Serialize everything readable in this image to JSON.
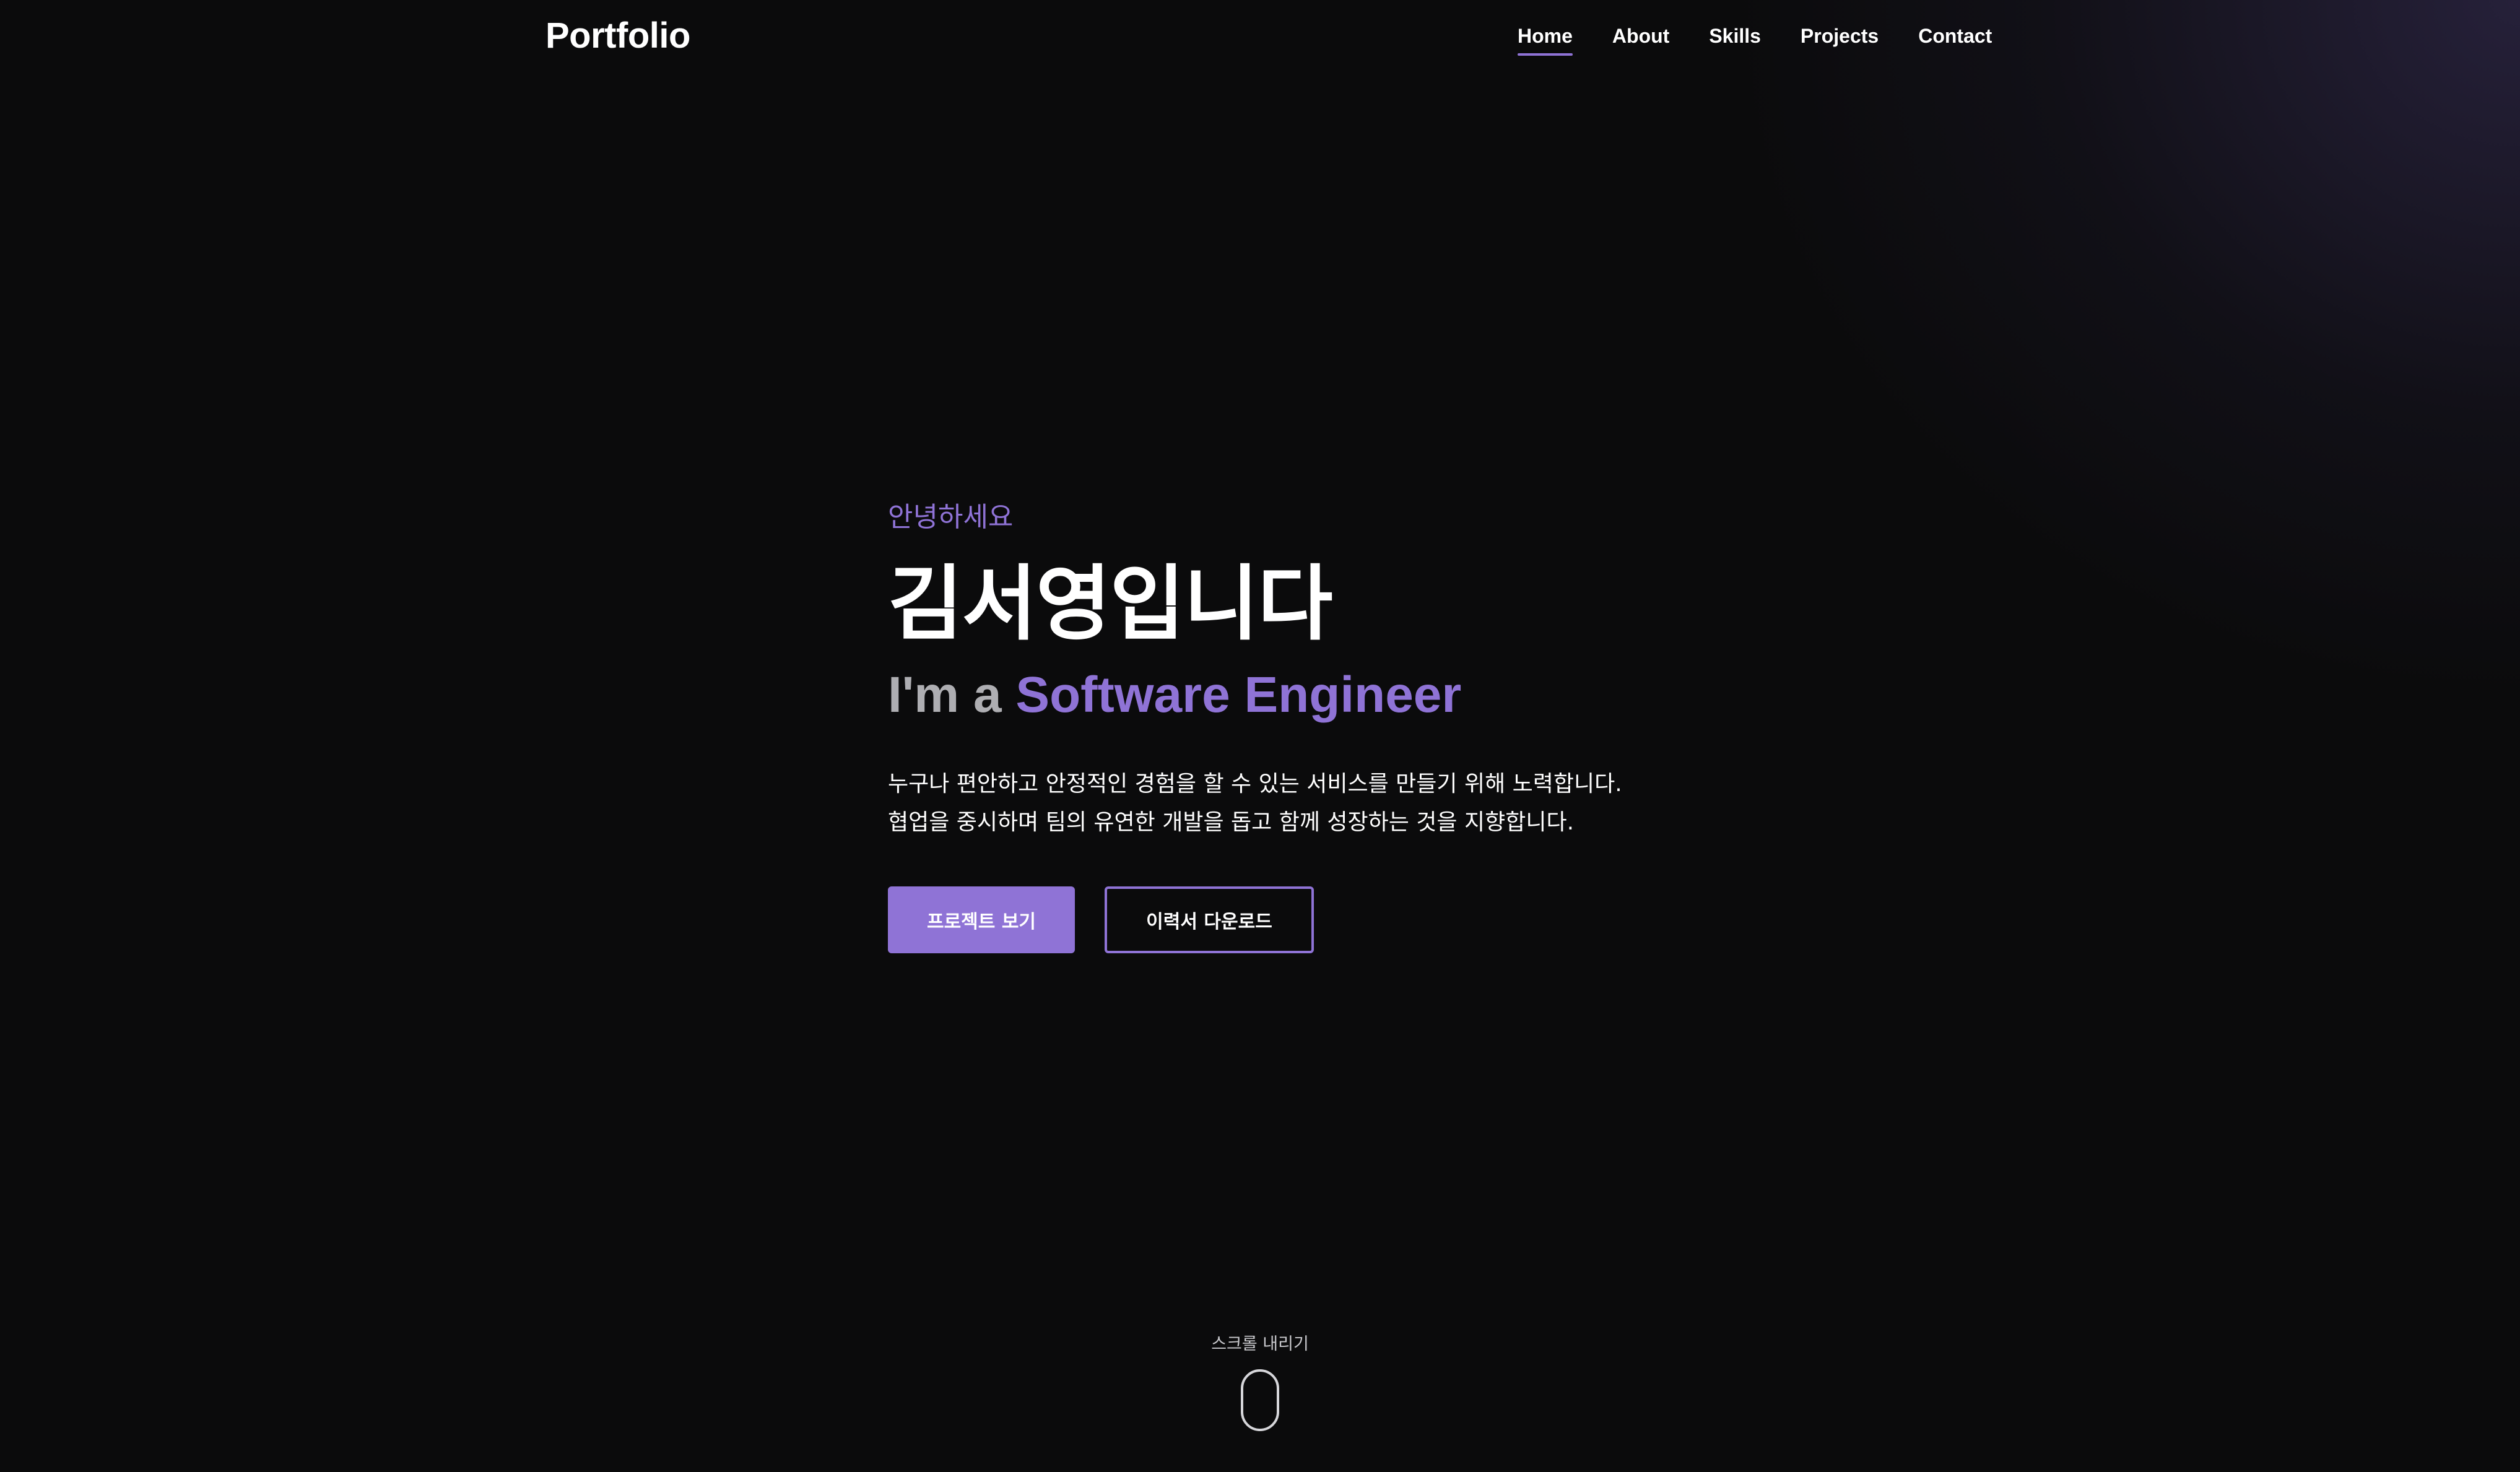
{
  "header": {
    "logo": "Portfolio",
    "nav": [
      {
        "label": "Home",
        "active": true
      },
      {
        "label": "About",
        "active": false
      },
      {
        "label": "Skills",
        "active": false
      },
      {
        "label": "Projects",
        "active": false
      },
      {
        "label": "Contact",
        "active": false
      }
    ]
  },
  "hero": {
    "greeting": "안녕하세요",
    "name": "김서영입니다",
    "role_prefix": "I'm a ",
    "role_highlight": "Software Engineer",
    "intro_lines": [
      "누구나 편안하고 안정적인 경험을 할 수 있는 서비스를 만들기 위해 노력합니다.",
      "협업을 중시하며 팀의 유연한 개발을 돕고 함께 성장하는 것을 지향합니다."
    ],
    "primary_button": "프로젝트 보기",
    "secondary_button": "이력서 다운로드"
  },
  "scroll": {
    "label": "스크롤 내리기",
    "icon": "mouse-icon"
  },
  "colors": {
    "background": "#0b0b0c",
    "accent": "#8f73d6",
    "text": "#ffffff",
    "muted": "#aeaeb2"
  }
}
